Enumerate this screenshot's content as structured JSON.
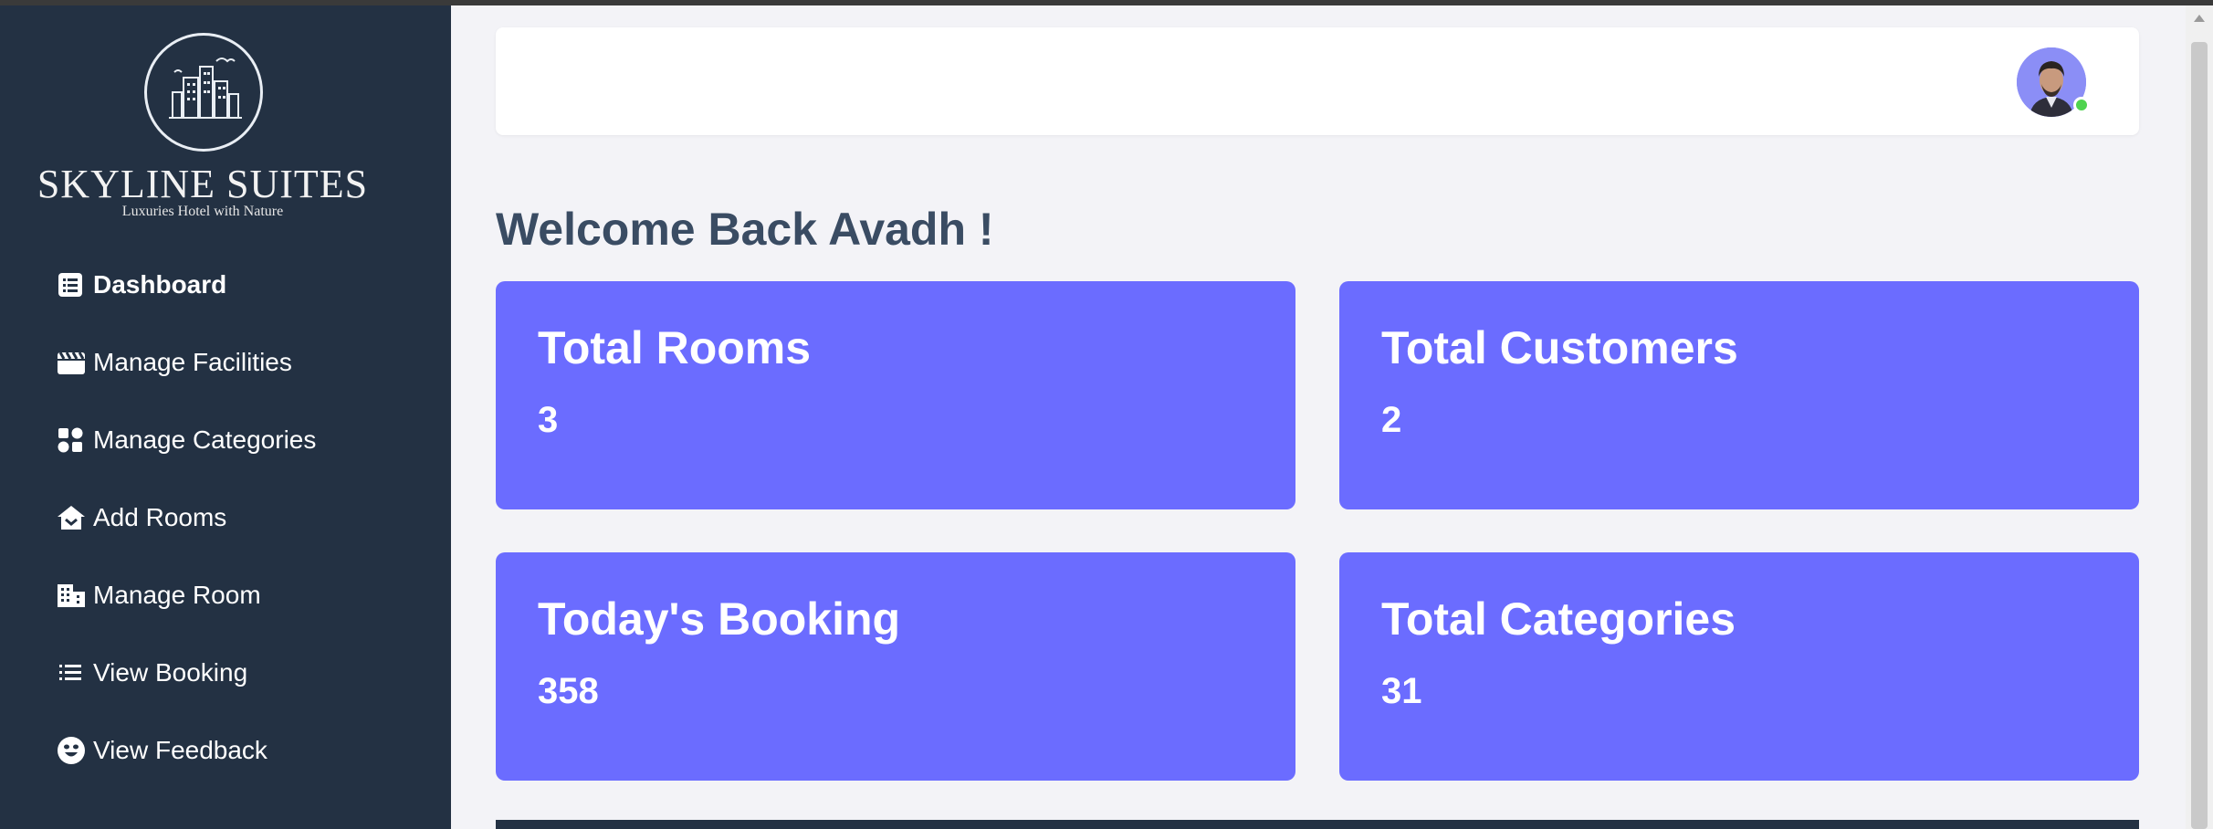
{
  "brand": {
    "title": "SKYLINE SUITES",
    "subtitle": "Luxuries Hotel with Nature"
  },
  "nav": {
    "items": [
      {
        "label": "Dashboard",
        "icon": "dashboard-icon",
        "active": true
      },
      {
        "label": "Manage Facilities",
        "icon": "clapperboard-icon"
      },
      {
        "label": "Manage Categories",
        "icon": "categories-icon"
      },
      {
        "label": "Add Rooms",
        "icon": "house-add-icon"
      },
      {
        "label": "Manage Room",
        "icon": "building-icon"
      },
      {
        "label": "View Booking",
        "icon": "list-icon"
      },
      {
        "label": "View Feedback",
        "icon": "smiley-icon"
      }
    ]
  },
  "header": {
    "avatar": "user-avatar",
    "status_color": "#4fd34f"
  },
  "welcome": "Welcome Back Avadh !",
  "cards": [
    {
      "title": "Total Rooms",
      "value": "3"
    },
    {
      "title": "Total Customers",
      "value": "2"
    },
    {
      "title": "Today's Booking",
      "value": "358"
    },
    {
      "title": "Total Categories",
      "value": "31"
    }
  ],
  "colors": {
    "sidebar": "#233143",
    "card": "#6b6cff",
    "background": "#f3f3f7"
  }
}
